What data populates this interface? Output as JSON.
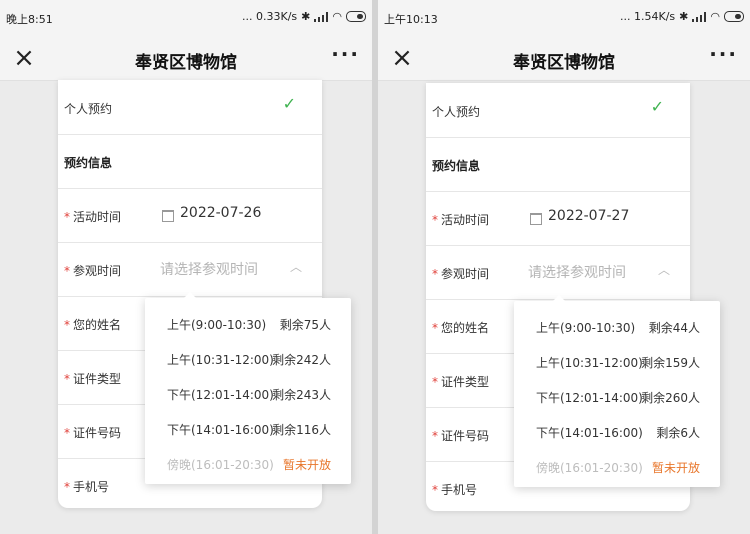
{
  "screens": [
    {
      "status": {
        "time": "晚上8:51",
        "net": "... 0.33K/s"
      },
      "nav": {
        "title": "奉贤区博物馆"
      },
      "form": {
        "personal": "个人预约",
        "section": "预约信息",
        "activity_label": "活动时间",
        "activity_value": "2022-07-26",
        "visit_label": "参观时间",
        "visit_placeholder": "请选择参观时间",
        "name_label": "您的姓名",
        "idtype_label": "证件类型",
        "idnum_label": "证件号码",
        "phone_label": "手机号"
      },
      "slots": [
        {
          "time": "上午(9:00-10:30)",
          "remain": "剩余75人"
        },
        {
          "time": "上午(10:31-12:00)",
          "remain": "剩余242人"
        },
        {
          "time": "下午(12:01-14:00)",
          "remain": "剩余243人"
        },
        {
          "time": "下午(14:01-16:00)",
          "remain": "剩余116人"
        },
        {
          "time": "傍晚(16:01-20:30)",
          "remain": "暂未开放"
        }
      ]
    },
    {
      "status": {
        "time": "上午10:13",
        "net": "... 1.54K/s"
      },
      "nav": {
        "title": "奉贤区博物馆"
      },
      "form": {
        "personal": "个人预约",
        "section": "预约信息",
        "activity_label": "活动时间",
        "activity_value": "2022-07-27",
        "visit_label": "参观时间",
        "visit_placeholder": "请选择参观时间",
        "name_label": "您的姓名",
        "idtype_label": "证件类型",
        "idnum_label": "证件号码",
        "phone_label": "手机号"
      },
      "slots": [
        {
          "time": "上午(9:00-10:30)",
          "remain": "剩余44人"
        },
        {
          "time": "上午(10:31-12:00)",
          "remain": "剩余159人"
        },
        {
          "time": "下午(12:01-14:00)",
          "remain": "剩余260人"
        },
        {
          "time": "下午(14:01-16:00)",
          "remain": "剩余6人"
        },
        {
          "time": "傍晚(16:01-20:30)",
          "remain": "暂未开放"
        }
      ]
    }
  ],
  "icons": {
    "close": "close-icon",
    "more": "more-icon",
    "check": "check-icon",
    "calendar": "calendar-icon",
    "chevron": "chevron-up-icon"
  },
  "colors": {
    "required": "#e0403a",
    "check": "#3fb350",
    "unavailable": "#e8762b"
  }
}
